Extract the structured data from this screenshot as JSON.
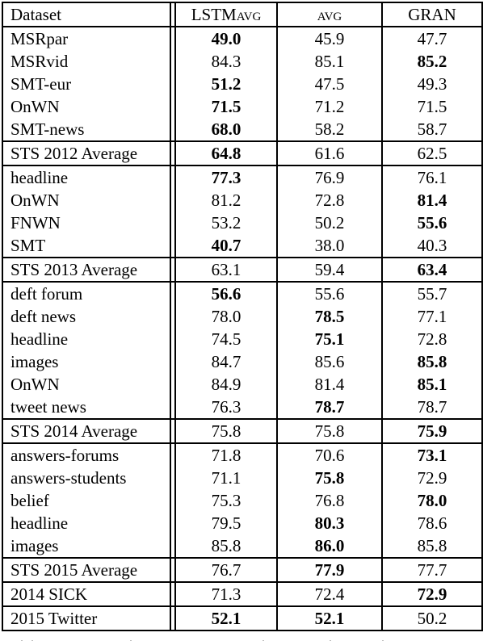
{
  "table": {
    "headers": [
      "Dataset",
      "LSTMAVG",
      "AVG",
      "GRAN"
    ],
    "header_display": {
      "lstm_prefix": "LSTM",
      "lstm_suffix": "avg",
      "avg": "avg",
      "gran": "GRAN"
    },
    "groups": [
      {
        "rows": [
          {
            "dataset": "MSRpar",
            "values": [
              "49.0",
              "45.9",
              "47.7"
            ],
            "bold": [
              true,
              false,
              false
            ]
          },
          {
            "dataset": "MSRvid",
            "values": [
              "84.3",
              "85.1",
              "85.2"
            ],
            "bold": [
              false,
              false,
              true
            ]
          },
          {
            "dataset": "SMT-eur",
            "values": [
              "51.2",
              "47.5",
              "49.3"
            ],
            "bold": [
              true,
              false,
              false
            ]
          },
          {
            "dataset": "OnWN",
            "values": [
              "71.5",
              "71.2",
              "71.5"
            ],
            "bold": [
              true,
              false,
              false
            ]
          },
          {
            "dataset": "SMT-news",
            "values": [
              "68.0",
              "58.2",
              "58.7"
            ],
            "bold": [
              true,
              false,
              false
            ]
          }
        ],
        "average": {
          "dataset": "STS 2012 Average",
          "values": [
            "64.8",
            "61.6",
            "62.5"
          ],
          "bold": [
            true,
            false,
            false
          ]
        }
      },
      {
        "rows": [
          {
            "dataset": "headline",
            "values": [
              "77.3",
              "76.9",
              "76.1"
            ],
            "bold": [
              true,
              false,
              false
            ]
          },
          {
            "dataset": "OnWN",
            "values": [
              "81.2",
              "72.8",
              "81.4"
            ],
            "bold": [
              false,
              false,
              true
            ]
          },
          {
            "dataset": "FNWN",
            "values": [
              "53.2",
              "50.2",
              "55.6"
            ],
            "bold": [
              false,
              false,
              true
            ]
          },
          {
            "dataset": "SMT",
            "values": [
              "40.7",
              "38.0",
              "40.3"
            ],
            "bold": [
              true,
              false,
              false
            ]
          }
        ],
        "average": {
          "dataset": "STS 2013 Average",
          "values": [
            "63.1",
            "59.4",
            "63.4"
          ],
          "bold": [
            false,
            false,
            true
          ]
        }
      },
      {
        "rows": [
          {
            "dataset": "deft forum",
            "values": [
              "56.6",
              "55.6",
              "55.7"
            ],
            "bold": [
              true,
              false,
              false
            ]
          },
          {
            "dataset": "deft news",
            "values": [
              "78.0",
              "78.5",
              "77.1"
            ],
            "bold": [
              false,
              true,
              false
            ]
          },
          {
            "dataset": "headline",
            "values": [
              "74.5",
              "75.1",
              "72.8"
            ],
            "bold": [
              false,
              true,
              false
            ]
          },
          {
            "dataset": "images",
            "values": [
              "84.7",
              "85.6",
              "85.8"
            ],
            "bold": [
              false,
              false,
              true
            ]
          },
          {
            "dataset": "OnWN",
            "values": [
              "84.9",
              "81.4",
              "85.1"
            ],
            "bold": [
              false,
              false,
              true
            ]
          },
          {
            "dataset": "tweet news",
            "values": [
              "76.3",
              "78.7",
              "78.7"
            ],
            "bold": [
              false,
              true,
              false
            ]
          }
        ],
        "average": {
          "dataset": "STS 2014 Average",
          "values": [
            "75.8",
            "75.8",
            "75.9"
          ],
          "bold": [
            false,
            false,
            true
          ]
        }
      },
      {
        "rows": [
          {
            "dataset": "answers-forums",
            "values": [
              "71.8",
              "70.6",
              "73.1"
            ],
            "bold": [
              false,
              false,
              true
            ]
          },
          {
            "dataset": "answers-students",
            "values": [
              "71.1",
              "75.8",
              "72.9"
            ],
            "bold": [
              false,
              true,
              false
            ]
          },
          {
            "dataset": "belief",
            "values": [
              "75.3",
              "76.8",
              "78.0"
            ],
            "bold": [
              false,
              false,
              true
            ]
          },
          {
            "dataset": "headline",
            "values": [
              "79.5",
              "80.3",
              "78.6"
            ],
            "bold": [
              false,
              true,
              false
            ]
          },
          {
            "dataset": "images",
            "values": [
              "85.8",
              "86.0",
              "85.8"
            ],
            "bold": [
              false,
              true,
              false
            ]
          }
        ],
        "average": {
          "dataset": "STS 2015 Average",
          "values": [
            "76.7",
            "77.9",
            "77.7"
          ],
          "bold": [
            false,
            true,
            false
          ]
        }
      }
    ],
    "extra_rows": [
      {
        "dataset": "2014 SICK",
        "values": [
          "71.3",
          "72.4",
          "72.9"
        ],
        "bold": [
          false,
          false,
          true
        ]
      },
      {
        "dataset": "2015 Twitter",
        "values": [
          "52.1",
          "52.1",
          "50.2"
        ],
        "bold": [
          true,
          true,
          false
        ]
      }
    ]
  }
}
